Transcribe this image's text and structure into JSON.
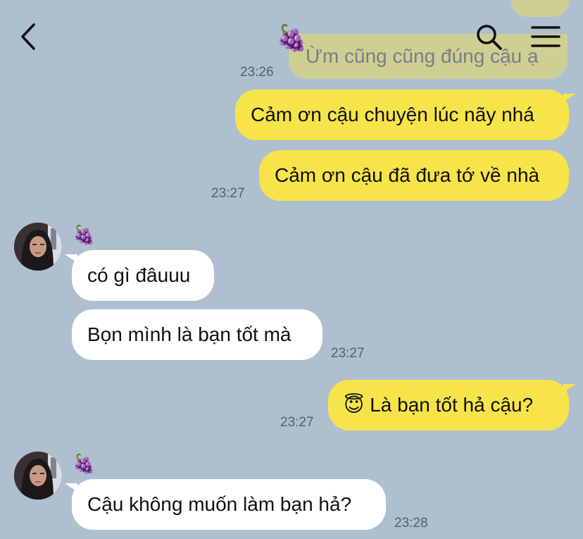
{
  "header": {
    "back_icon": "chevron-left-icon",
    "title_emoji": "🍇",
    "search_icon": "search-icon",
    "menu_icon": "hamburger-menu-icon"
  },
  "messages": {
    "m1": {
      "text": "Ừm cũng cũng đúng cậu ạ",
      "time": "23:26"
    },
    "m2": {
      "text": "Cảm ơn cậu chuyện lúc nãy nhá"
    },
    "m3": {
      "text": "Cảm ơn cậu đã đưa tớ về nhà",
      "time": "23:27"
    },
    "sender1": {
      "name_emoji": "🍇"
    },
    "m4": {
      "text": "có gì đâuuu"
    },
    "m5": {
      "text": "Bọn mình là bạn tốt mà",
      "time": "23:27"
    },
    "m6": {
      "emoji": "😇",
      "text": "Là bạn tốt hả cậu?",
      "time": "23:27"
    },
    "sender2": {
      "name_emoji": "🍇"
    },
    "m7": {
      "text": "Cậu không muốn làm bạn hả?",
      "time": "23:28"
    }
  },
  "colors": {
    "background": "#aebfd0",
    "outgoing_bubble": "#f6e44a",
    "incoming_bubble": "#ffffff",
    "timestamp": "#56606b"
  }
}
